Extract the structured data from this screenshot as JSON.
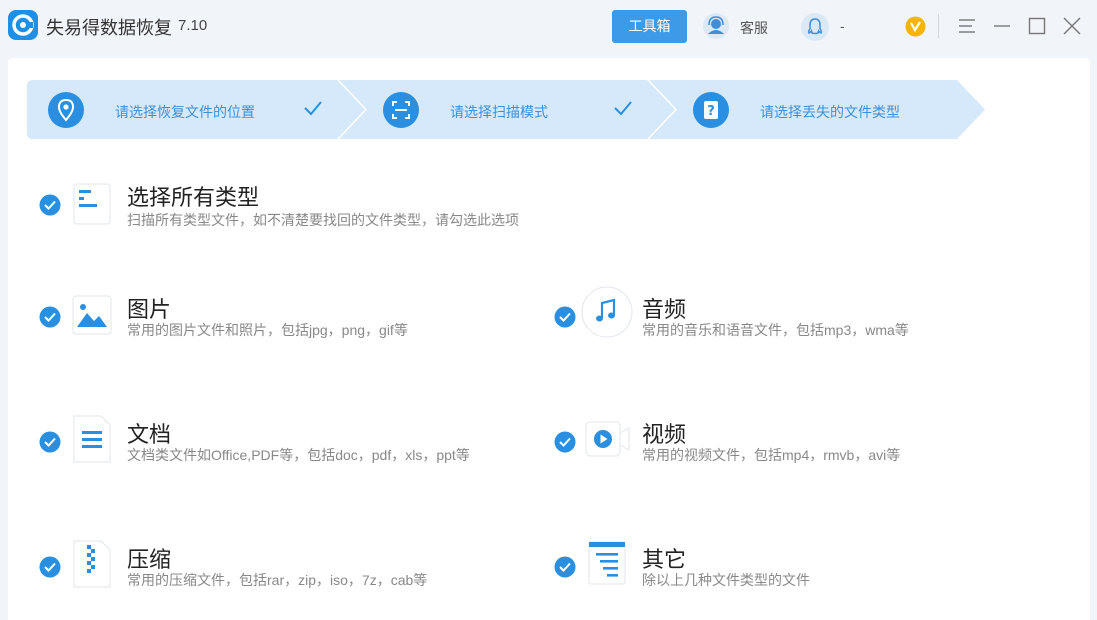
{
  "app": {
    "title": "失易得数据恢复",
    "version": "7.10",
    "toolbox_label": "工具箱",
    "customer_service_label": "客服",
    "qq_label": "-"
  },
  "colors": {
    "accent": "#3d9ae8",
    "step_bg": "#d6e9fa",
    "step_text": "#3d8fdc",
    "check": "#2a8fe0"
  },
  "steps": [
    {
      "label": "请选择恢复文件的位置",
      "icon": "location-pin-icon",
      "done": true
    },
    {
      "label": "请选择扫描模式",
      "icon": "scan-icon",
      "done": true
    },
    {
      "label": "请选择丢失的文件类型",
      "icon": "question-icon",
      "done": false
    }
  ],
  "categories": {
    "all": {
      "title": "选择所有类型",
      "desc": "扫描所有类型文件，如不清楚要找回的文件类型，请勾选此选项",
      "icon": "all-types-icon",
      "checked": true
    },
    "image": {
      "title": "图片",
      "desc": "常用的图片文件和照片，包括jpg，png，gif等",
      "icon": "image-icon",
      "checked": true
    },
    "audio": {
      "title": "音频",
      "desc": "常用的音乐和语音文件，包括mp3，wma等",
      "icon": "music-note-icon",
      "checked": true
    },
    "document": {
      "title": "文档",
      "desc": "文档类文件如Office,PDF等，包括doc，pdf，xls，ppt等",
      "icon": "document-icon",
      "checked": true
    },
    "video": {
      "title": "视频",
      "desc": "常用的视频文件，包括mp4，rmvb，avi等",
      "icon": "video-icon",
      "checked": true
    },
    "archive": {
      "title": "压缩",
      "desc": "常用的压缩文件，包括rar，zip，iso，7z，cab等",
      "icon": "zip-icon",
      "checked": true
    },
    "other": {
      "title": "其它",
      "desc": "除以上几种文件类型的文件",
      "icon": "other-files-icon",
      "checked": true
    }
  }
}
